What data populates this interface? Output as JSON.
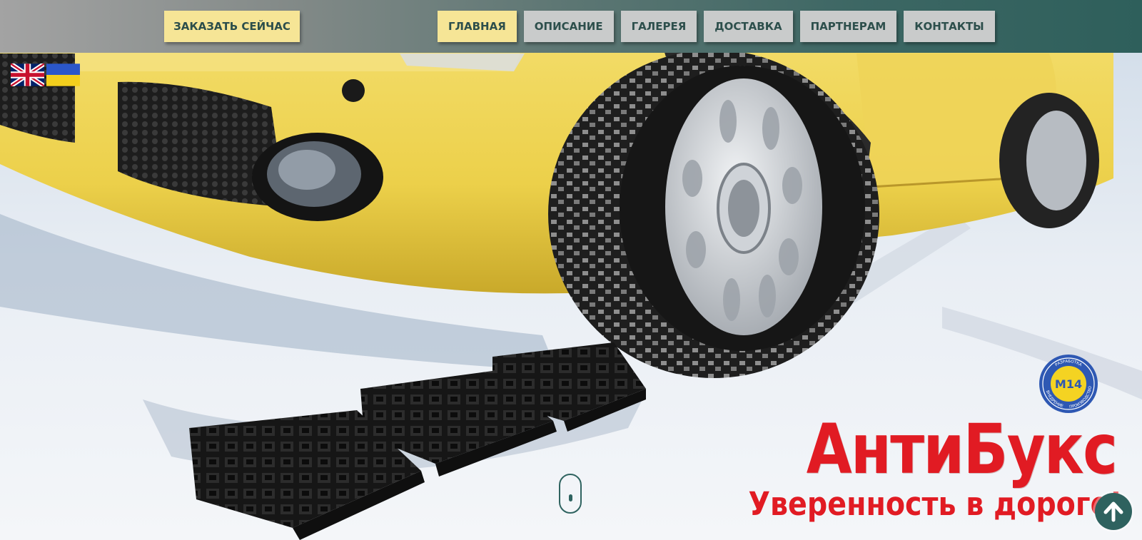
{
  "header": {
    "order_button": "ЗАКАЗАТЬ СЕЙЧАС",
    "nav": [
      {
        "label": "ГЛАВНАЯ",
        "active": true
      },
      {
        "label": "ОПИСАНИЕ",
        "active": false
      },
      {
        "label": "ГАЛЕРЕЯ",
        "active": false
      },
      {
        "label": "ДОСТАВКА",
        "active": false
      },
      {
        "label": "ПАРТНЕРАМ",
        "active": false
      },
      {
        "label": "КОНТАКТЫ",
        "active": false
      }
    ]
  },
  "languages": [
    {
      "icon": "uk-flag-icon"
    },
    {
      "icon": "ukraine-flag-icon"
    }
  ],
  "hero": {
    "title": "АнтиБукс",
    "subtitle": "Уверенность в дороге!",
    "background": "yellow-car-wheel-on-traction-mats-in-snow"
  },
  "badge": {
    "center_text": "M14",
    "ring_text": [
      "РАЗРАБОТКА",
      "ВНЕДРЕНИЕ",
      "ПРОИЗВОДСТВО"
    ]
  },
  "icons": {
    "scroll": "scroll-down-mouse-icon",
    "to_top": "arrow-up-icon"
  },
  "colors": {
    "header_left": "#a3a3a3",
    "header_right": "#2e5f5b",
    "accent_yellow": "#f6e596",
    "nav_gray": "#c9cbcb",
    "nav_text": "#2d4f4c",
    "title_red": "#e11b23",
    "teal": "#2e625f"
  }
}
